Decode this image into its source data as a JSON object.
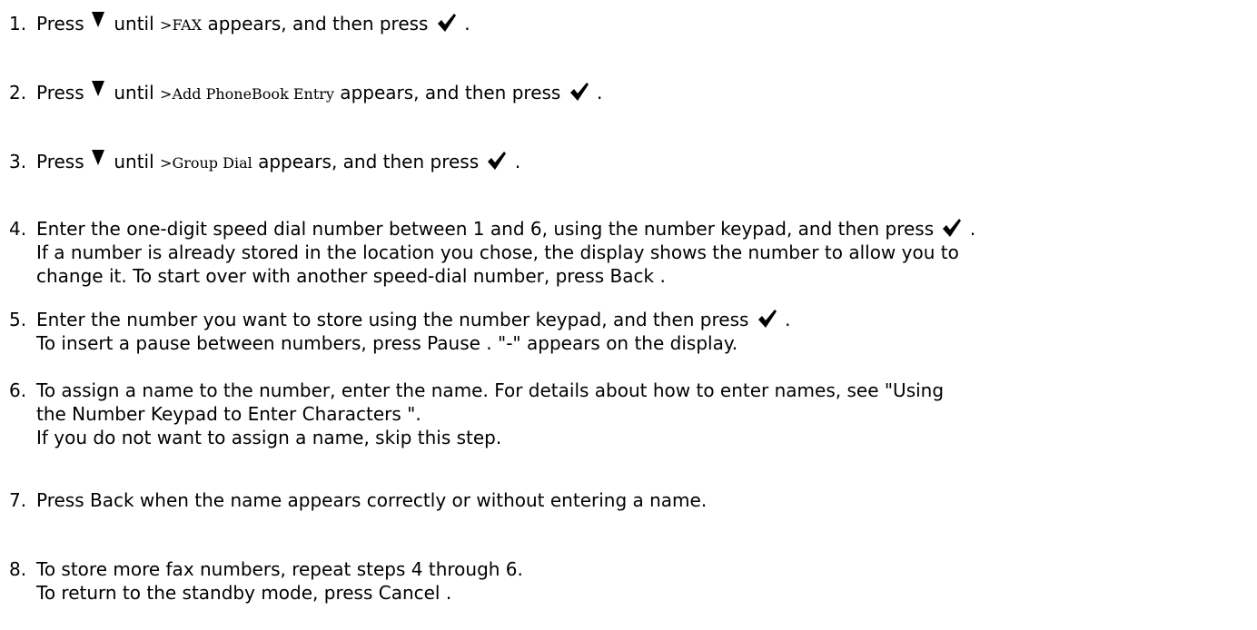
{
  "steps": [
    {
      "number": "1.",
      "lines": [
        {
          "parts": [
            {
              "t": "text",
              "v": "Press "
            },
            {
              "t": "icon",
              "v": "down-arrow"
            },
            {
              "t": "text",
              "v": " until "
            },
            {
              "t": "mono",
              "v": ">FAX"
            },
            {
              "t": "text",
              "v": " appears, and then press "
            },
            {
              "t": "icon",
              "v": "check"
            },
            {
              "t": "text",
              "v": " ."
            }
          ]
        }
      ]
    },
    {
      "number": "2.",
      "lines": [
        {
          "parts": [
            {
              "t": "text",
              "v": "Press "
            },
            {
              "t": "icon",
              "v": "down-arrow"
            },
            {
              "t": "text",
              "v": " until "
            },
            {
              "t": "mono",
              "v": ">Add PhoneBook Entry"
            },
            {
              "t": "text",
              "v": " appears, and then press "
            },
            {
              "t": "icon",
              "v": "check"
            },
            {
              "t": "text",
              "v": " ."
            }
          ]
        }
      ]
    },
    {
      "number": "3.",
      "lines": [
        {
          "parts": [
            {
              "t": "text",
              "v": "Press "
            },
            {
              "t": "icon",
              "v": "down-arrow"
            },
            {
              "t": "text",
              "v": " until "
            },
            {
              "t": "mono",
              "v": ">Group Dial"
            },
            {
              "t": "text",
              "v": " appears, and then press "
            },
            {
              "t": "icon",
              "v": "check"
            },
            {
              "t": "text",
              "v": " ."
            }
          ]
        }
      ]
    },
    {
      "number": "4.",
      "lines": [
        {
          "parts": [
            {
              "t": "text",
              "v": "Enter the one-digit speed dial number between 1 and 6, using the number keypad, and then press "
            },
            {
              "t": "icon",
              "v": "check"
            },
            {
              "t": "text",
              "v": " ."
            }
          ]
        },
        {
          "parts": [
            {
              "t": "text",
              "v": "If a number is already stored in the location you chose, the display shows the number to allow you to"
            }
          ]
        },
        {
          "parts": [
            {
              "t": "text",
              "v": "change it. To start over with another speed-dial number, press Back ."
            }
          ]
        }
      ]
    },
    {
      "number": "5.",
      "lines": [
        {
          "parts": [
            {
              "t": "text",
              "v": "Enter the number you want to store using the number keypad, and then press "
            },
            {
              "t": "icon",
              "v": "check"
            },
            {
              "t": "text",
              "v": " ."
            }
          ]
        },
        {
          "parts": [
            {
              "t": "text",
              "v": "To insert a pause between numbers, press Pause . \"-\" appears on the display."
            }
          ]
        }
      ]
    },
    {
      "number": "6.",
      "lines": [
        {
          "parts": [
            {
              "t": "text",
              "v": "To assign a name to the number, enter the name. For details about how to enter names, see \"Using"
            }
          ]
        },
        {
          "parts": [
            {
              "t": "text",
              "v": "the Number Keypad to Enter Characters \"."
            }
          ]
        },
        {
          "parts": [
            {
              "t": "text",
              "v": "If you do not want to assign a name, skip this step."
            }
          ]
        }
      ]
    },
    {
      "number": "7.",
      "lines": [
        {
          "parts": [
            {
              "t": "text",
              "v": "Press Back when the name appears correctly or without entering a name."
            }
          ]
        }
      ]
    },
    {
      "number": "8.",
      "lines": [
        {
          "parts": [
            {
              "t": "text",
              "v": "To store more fax numbers, repeat steps 4 through 6."
            }
          ]
        },
        {
          "parts": [
            {
              "t": "text",
              "v": "To return to the standby mode, press Cancel ."
            }
          ]
        }
      ]
    }
  ]
}
